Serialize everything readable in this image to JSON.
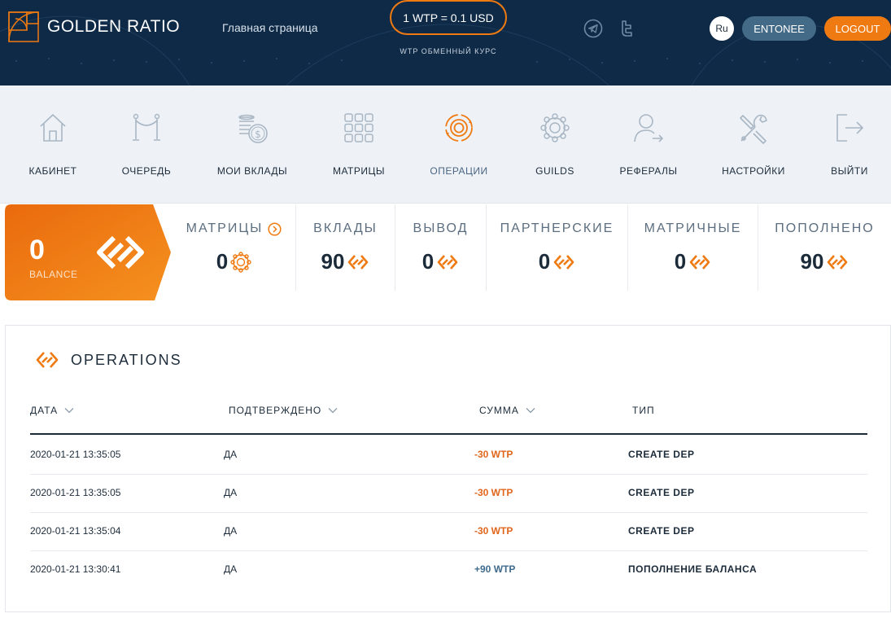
{
  "header": {
    "logo_text": "GOLDEN RATIO",
    "nav_home": "Главная страница",
    "rate": "1 WTP = 0.1 USD",
    "rate_caption": "WTP ОБМЕННЫЙ КУРС",
    "social": [
      "telegram-icon",
      "twitter-icon"
    ],
    "lang": "Ru",
    "user": "ENTONEE",
    "logout": "LOGOUT"
  },
  "menu": {
    "items": [
      {
        "label": "КАБИНЕТ",
        "icon": "home-icon"
      },
      {
        "label": "ОЧЕРЕДЬ",
        "icon": "queue-icon"
      },
      {
        "label": "МОИ ВКЛАДЫ",
        "icon": "coins-icon"
      },
      {
        "label": "МАТРИЦЫ",
        "icon": "grid-icon"
      },
      {
        "label": "ОПЕРАЦИИ",
        "icon": "operations-icon",
        "active": true
      },
      {
        "label": "GUILDS",
        "icon": "guilds-icon"
      },
      {
        "label": "РЕФЕРАЛЫ",
        "icon": "referrals-icon"
      },
      {
        "label": "НАСТРОЙКИ",
        "icon": "settings-icon"
      },
      {
        "label": "ВЫЙТИ",
        "icon": "logout-icon"
      }
    ]
  },
  "balance": {
    "value": "0",
    "label": "BALANCE"
  },
  "stats": [
    {
      "label": "МАТРИЦЫ",
      "value": "0"
    },
    {
      "label": "ВКЛАДЫ",
      "value": "90"
    },
    {
      "label": "ВЫВОД",
      "value": "0"
    },
    {
      "label": "ПАРТНЕРСКИЕ",
      "value": "0"
    },
    {
      "label": "МАТРИЧНЫЕ",
      "value": "0"
    },
    {
      "label": "ПОПОЛНЕНО",
      "value": "90"
    }
  ],
  "operations": {
    "title": "OPERATIONS",
    "columns": [
      "ДАТА",
      "ПОДТВЕРЖДЕНО",
      "СУММА",
      "ТИП"
    ],
    "rows": [
      {
        "date": "2020-01-21 13:35:05",
        "confirmed": "ДА",
        "amount": "-30 WTP",
        "type": "CREATE DEP"
      },
      {
        "date": "2020-01-21 13:35:05",
        "confirmed": "ДА",
        "amount": "-30 WTP",
        "type": "CREATE DEP"
      },
      {
        "date": "2020-01-21 13:35:04",
        "confirmed": "ДА",
        "amount": "-30 WTP",
        "type": "CREATE DEP"
      },
      {
        "date": "2020-01-21 13:30:41",
        "confirmed": "ДА",
        "amount": "+90 WTP",
        "type": "ПОПОЛНЕНИЕ БАЛАНСА"
      }
    ]
  },
  "colors": {
    "accent": "#f07a12",
    "header_bg": "#0e2a47",
    "negative": "#e0661c",
    "positive": "#3f6b8d"
  }
}
